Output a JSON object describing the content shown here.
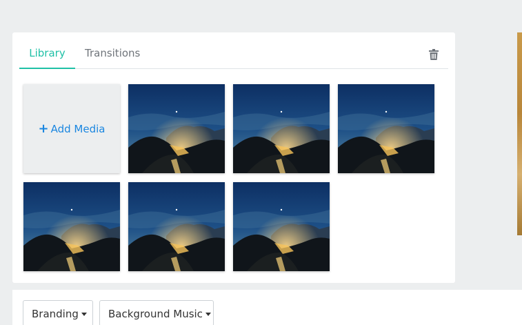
{
  "tabs": [
    {
      "label": "Library",
      "active": true
    },
    {
      "label": "Transitions",
      "active": false
    }
  ],
  "library": {
    "add_media_label": "Add Media",
    "add_media_icon": "plus-icon",
    "thumbnail_count": 7
  },
  "bottom": {
    "branding_label": "Branding",
    "music_label": "Background Music"
  },
  "colors": {
    "accent": "#1fc0a6",
    "link": "#1a86e0",
    "background": "#eceeef"
  }
}
